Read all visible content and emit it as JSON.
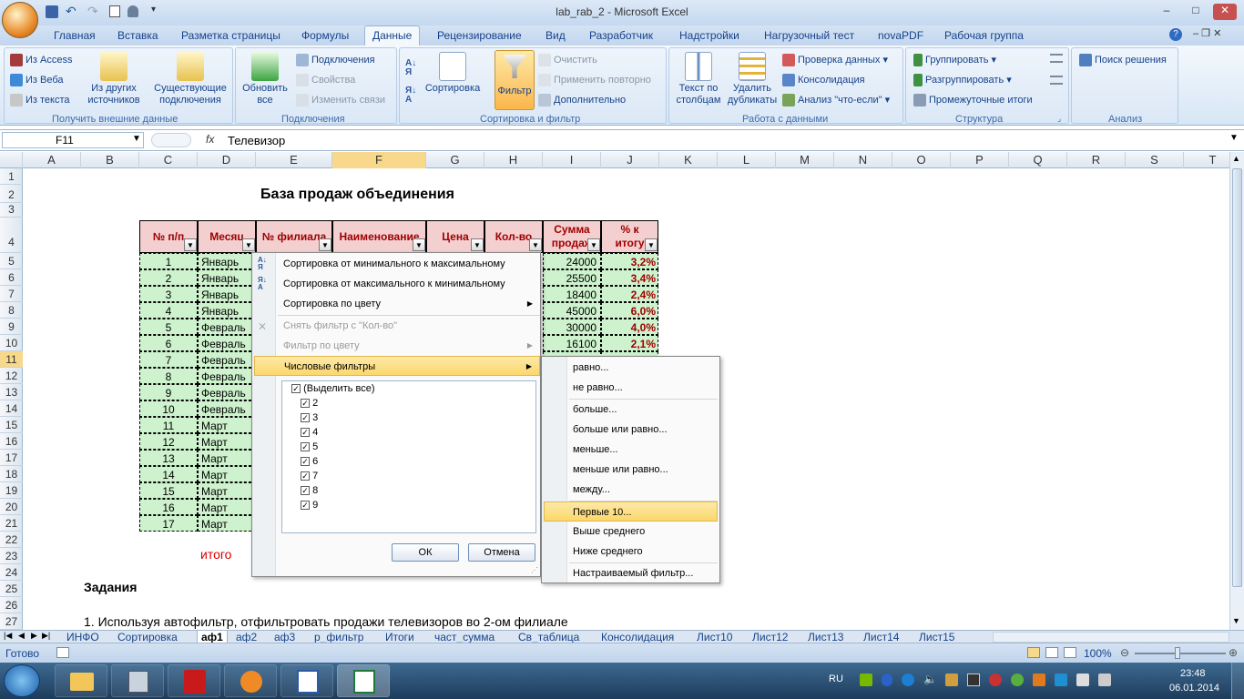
{
  "window": {
    "title": "lab_rab_2 - Microsoft Excel"
  },
  "menu_tabs": [
    "Главная",
    "Вставка",
    "Разметка страницы",
    "Формулы",
    "Данные",
    "Рецензирование",
    "Вид",
    "Разработчик",
    "Надстройки",
    "Нагрузочный тест",
    "novaPDF",
    "Рабочая группа"
  ],
  "ribbon": {
    "ext": {
      "access": "Из Access",
      "web": "Из Веба",
      "text": "Из текста",
      "other1": "Из других",
      "other2": "источников",
      "exist1": "Существующие",
      "exist2": "подключения",
      "label": "Получить внешние данные"
    },
    "conn": {
      "refresh1": "Обновить",
      "refresh2": "все",
      "connections": "Подключения",
      "props": "Свойства",
      "edit_links": "Изменить связи",
      "label": "Подключения"
    },
    "sort": {
      "sort": "Сортировка",
      "filter": "Фильтр",
      "clear": "Очистить",
      "reapply": "Применить повторно",
      "advanced": "Дополнительно",
      "label": "Сортировка и фильтр"
    },
    "tools": {
      "text1": "Текст по",
      "text2": "столбцам",
      "dup1": "Удалить",
      "dup2": "дубликаты",
      "validate": "Проверка данных",
      "consolidate": "Консолидация",
      "whatif": "Анализ \"что-если\"",
      "label": "Работа с данными"
    },
    "outline": {
      "group": "Группировать",
      "ungroup": "Разгруппировать",
      "subtotal": "Промежуточные итоги",
      "label": "Структура"
    },
    "analysis": {
      "solver": "Поиск решения",
      "label": "Анализ"
    }
  },
  "formula_bar": {
    "name_box": "F11",
    "fx": "fx",
    "value": "Телевизор"
  },
  "columns": [
    "A",
    "B",
    "C",
    "D",
    "E",
    "F",
    "G",
    "H",
    "I",
    "J",
    "K",
    "L",
    "M",
    "N",
    "O",
    "P",
    "Q",
    "R",
    "S",
    "T"
  ],
  "rows": [
    "1",
    "2",
    "3",
    "4",
    "5",
    "6",
    "7",
    "8",
    "9",
    "10",
    "11",
    "12",
    "13",
    "14",
    "15",
    "16",
    "17",
    "18",
    "19",
    "20",
    "21",
    "22",
    "23",
    "24",
    "25",
    "26",
    "27"
  ],
  "sheet": {
    "title": "База продаж объединения",
    "headers": {
      "n": "№ п/п",
      "month": "Месяц",
      "branch": "№ филиала",
      "name": "Наименование",
      "price": "Цена",
      "qty": "Кол-во",
      "sum1": "Сумма",
      "sum2": "продаж",
      "pct1": "% к",
      "pct2": "итогу"
    },
    "data_rows": [
      {
        "n": "1",
        "m": "Январь",
        "s": "24000",
        "p": "3,2%"
      },
      {
        "n": "2",
        "m": "Январь",
        "s": "25500",
        "p": "3,4%"
      },
      {
        "n": "3",
        "m": "Январь",
        "s": "18400",
        "p": "2,4%"
      },
      {
        "n": "4",
        "m": "Январь",
        "s": "45000",
        "p": "6,0%"
      },
      {
        "n": "5",
        "m": "Февраль",
        "s": "30000",
        "p": "4,0%"
      },
      {
        "n": "6",
        "m": "Февраль",
        "s": "16100",
        "p": "2,1%"
      },
      {
        "n": "7",
        "m": "Февраль",
        "s": "",
        "p": ""
      },
      {
        "n": "8",
        "m": "Февраль",
        "s": "",
        "p": ""
      },
      {
        "n": "9",
        "m": "Февраль",
        "s": "",
        "p": ""
      },
      {
        "n": "10",
        "m": "Февраль",
        "s": "",
        "p": ""
      },
      {
        "n": "11",
        "m": "Март",
        "s": "",
        "p": ""
      },
      {
        "n": "12",
        "m": "Март",
        "s": "",
        "p": ""
      },
      {
        "n": "13",
        "m": "Март",
        "s": "",
        "p": ""
      },
      {
        "n": "14",
        "m": "Март",
        "s": "",
        "p": ""
      },
      {
        "n": "15",
        "m": "Март",
        "s": "",
        "p": ""
      },
      {
        "n": "16",
        "m": "Март",
        "s": "",
        "p": ""
      },
      {
        "n": "17",
        "m": "Март",
        "s": "",
        "p": ""
      }
    ],
    "itogo": "итого",
    "tasks_title": "Задания",
    "task1": "1. Используя автофильтр, отфильтровать продажи телевизоров во 2-ом филиале"
  },
  "filter_menu": {
    "items": [
      "Сортировка от минимального к максимальному",
      "Сортировка от максимального к минимальному",
      "Сортировка по цвету",
      "Снять фильтр с \"Кол-во\"",
      "Фильтр по цвету",
      "Числовые фильтры"
    ],
    "checklist": [
      "(Выделить все)",
      "2",
      "3",
      "4",
      "5",
      "6",
      "7",
      "8",
      "9"
    ],
    "ok": "ОК",
    "cancel": "Отмена"
  },
  "submenu": [
    "равно...",
    "не равно...",
    "больше...",
    "больше или равно...",
    "меньше...",
    "меньше или равно...",
    "между...",
    "Первые 10...",
    "Выше среднего",
    "Ниже среднего",
    "Настраиваемый фильтр..."
  ],
  "sheet_tabs": [
    "ИНФО",
    "Сортировка",
    "аф1",
    "аф2",
    "аф3",
    "р_фильтр",
    "Итоги",
    "част_сумма",
    "Св_таблица",
    "Консолидация",
    "Лист10",
    "Лист12",
    "Лист13",
    "Лист14",
    "Лист15"
  ],
  "status": {
    "ready": "Готово",
    "zoom": "100%"
  },
  "taskbar": {
    "lang": "RU",
    "time": "23:48",
    "date": "06.01.2014"
  },
  "colors": {
    "header_bg": "#f3cfd0",
    "header_text": "#a00000",
    "data_bg": "#cdf2cd",
    "highlight": "#fbd76b"
  }
}
